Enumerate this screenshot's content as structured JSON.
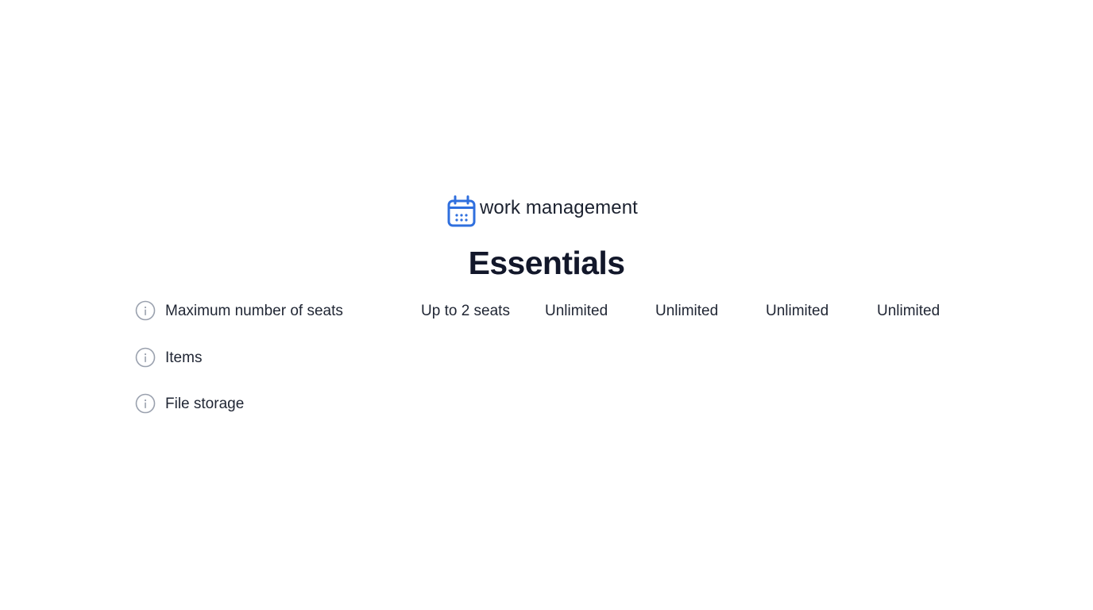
{
  "brand": {
    "icon": "calendar-icon",
    "text": "work management",
    "accent_color": "#2f6fde"
  },
  "heading": "Essentials",
  "features": [
    {
      "icon": "info-icon",
      "label": "Maximum number of seats",
      "values": [
        "Up to 2 seats",
        "Unlimited",
        "Unlimited",
        "Unlimited",
        "Unlimited"
      ]
    },
    {
      "icon": "info-icon",
      "label": "Items",
      "values": []
    },
    {
      "icon": "info-icon",
      "label": "File storage",
      "values": []
    }
  ]
}
